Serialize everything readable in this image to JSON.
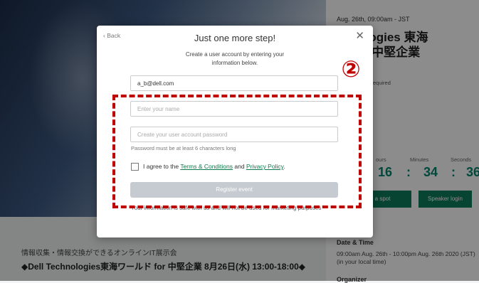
{
  "event": {
    "date": "Aug. 26th, 09:00am - JST",
    "title_line1": "chnologies 東海",
    "title_line2": "ド for 中堅企業",
    "requirement": "& microphone required",
    "countdown_labels": [
      "ours",
      "Minutes",
      "Seconds"
    ],
    "countdown_values": [
      "16",
      ":",
      "34",
      ":",
      "36"
    ],
    "save_spot_label": "e a spot",
    "speaker_login_label": "Speaker login",
    "datetime_heading": "Date & Time",
    "datetime_text": "09:00am Aug. 26th - 10:00pm Aug. 26th 2020 (JST) (in your local time)",
    "organizer_heading": "Organizer"
  },
  "page": {
    "subtitle": "情報収集・情報交換ができるオンラインIT展示会",
    "title": "◆Dell Technologies東海ワールド for 中堅企業 8月26日(水) 13:00-18:00◆"
  },
  "modal": {
    "back_label": "Back",
    "back_icon": "chevron-left-icon",
    "close_icon": "close-icon",
    "title": "Just one more step!",
    "description": "Create a user account by entering your information below.",
    "email_value": "a_b@dell.com",
    "name_placeholder": "Enter your name",
    "password_placeholder": "Create your user account password",
    "password_hint": "Password must be at least 6 characters long",
    "agree_prefix": "I agree to the",
    "terms_label": "Terms & Conditions",
    "agree_and": "and",
    "privacy_label": "Privacy Policy",
    "agree_suffix": ".",
    "register_label": "Register event",
    "safe_note": "Your information is safe with us and will not be used for marketing purposes"
  },
  "annotation": {
    "badge": "②"
  },
  "colors": {
    "accent": "#0d7d5c",
    "annotation": "#c00000",
    "register_disabled": "#c5cbd1"
  }
}
